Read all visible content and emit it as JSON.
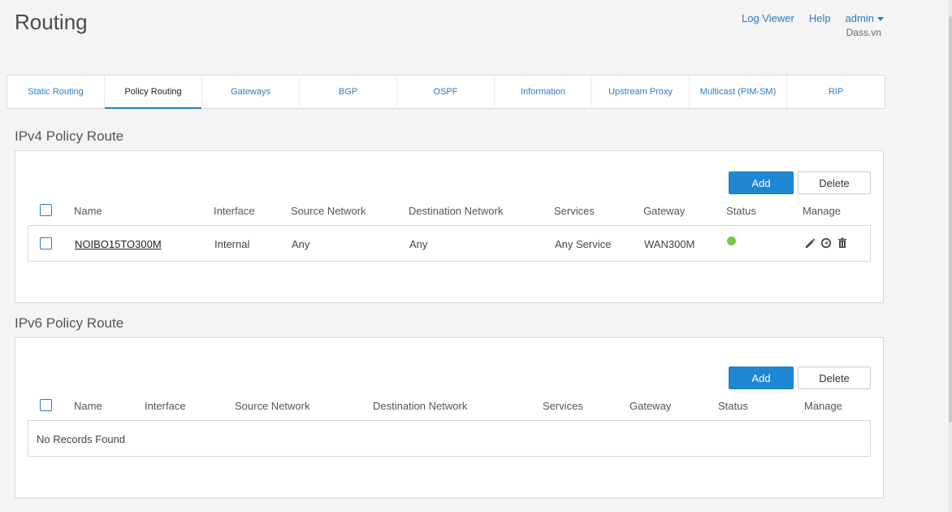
{
  "page": {
    "title": "Routing"
  },
  "header": {
    "links": {
      "log_viewer": "Log Viewer",
      "help": "Help",
      "admin": "admin"
    },
    "org_name": "Dass.vn"
  },
  "tabs": [
    {
      "label": "Static Routing"
    },
    {
      "label": "Policy Routing",
      "active": true
    },
    {
      "label": "Gateways"
    },
    {
      "label": "BGP"
    },
    {
      "label": "OSPF"
    },
    {
      "label": "Information"
    },
    {
      "label": "Upstream Proxy"
    },
    {
      "label": "Multicast (PIM-SM)"
    },
    {
      "label": "RIP"
    }
  ],
  "ipv4": {
    "title": "IPv4 Policy Route",
    "add_label": "Add",
    "delete_label": "Delete",
    "columns": [
      "Name",
      "Interface",
      "Source Network",
      "Destination Network",
      "Services",
      "Gateway",
      "Status",
      "Manage"
    ],
    "rows": [
      {
        "name": "NOIBO15TO300M",
        "interface": "Internal",
        "source_network": "Any",
        "destination_network": "Any",
        "services": "Any Service",
        "gateway": "WAN300M",
        "status": "active",
        "status_color": "#7ac943"
      }
    ]
  },
  "ipv6": {
    "title": "IPv6 Policy Route",
    "add_label": "Add",
    "delete_label": "Delete",
    "columns": [
      "Name",
      "Interface",
      "Source Network",
      "Destination Network",
      "Services",
      "Gateway",
      "Status",
      "Manage"
    ],
    "empty_text": "No Records Found"
  },
  "icons": {
    "edit": "pencil-icon",
    "reposition": "reposition-icon",
    "delete": "trash-icon"
  },
  "colors": {
    "accent": "#2b7bc4",
    "primary_button": "#1f87d1",
    "status_active": "#7ac943"
  }
}
